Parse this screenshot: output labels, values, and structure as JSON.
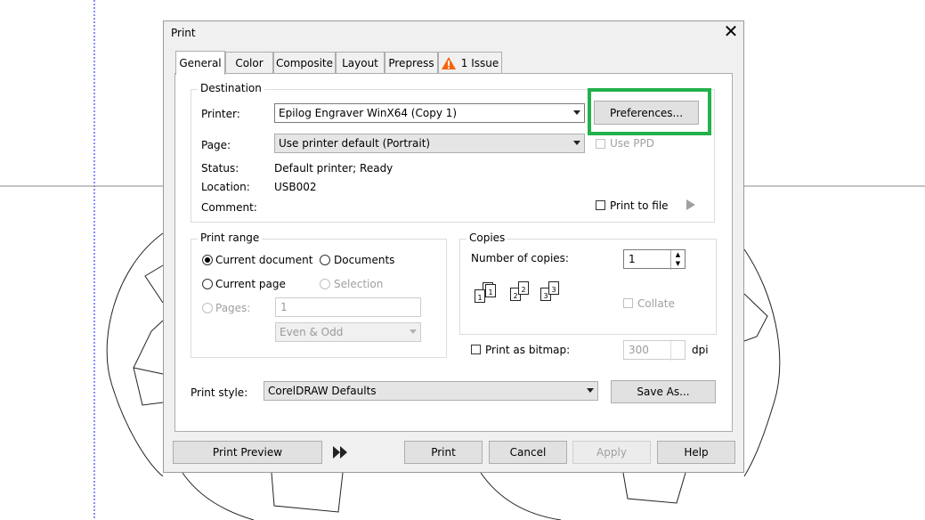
{
  "dialog": {
    "title": "Print",
    "close_icon": "close-icon",
    "tabs": [
      "General",
      "Color",
      "Composite",
      "Layout",
      "Prepress",
      "1 Issue"
    ],
    "issue_icon": "warning-icon",
    "issue_color": "#f7630c"
  },
  "destination": {
    "title": "Destination",
    "printer_label": "Printer:",
    "printer_value": "Epilog Engraver WinX64 (Copy 1)",
    "preferences_button": "Preferences...",
    "page_label": "Page:",
    "page_value": "Use printer default (Portrait)",
    "use_ppd": "Use PPD",
    "status_label": "Status:",
    "status_value": "Default printer; Ready",
    "location_label": "Location:",
    "location_value": "USB002",
    "comment_label": "Comment:",
    "print_to_file": "Print to file"
  },
  "print_range": {
    "title": "Print range",
    "current_document": "Current document",
    "documents": "Documents",
    "current_page": "Current page",
    "selection": "Selection",
    "pages_label": "Pages:",
    "pages_value": "1",
    "even_odd": "Even & Odd"
  },
  "copies": {
    "title": "Copies",
    "number_label": "Number of copies:",
    "number_value": "1",
    "collate": "Collate",
    "uncollated_pages": [
      "1",
      "1"
    ],
    "collated_pages": [
      "2",
      "2",
      "3",
      "3"
    ]
  },
  "bitmap": {
    "label": "Print as bitmap:",
    "dpi_value": "300",
    "dpi_unit": "dpi"
  },
  "style": {
    "label": "Print style:",
    "value": "CorelDRAW Defaults",
    "save_as": "Save As..."
  },
  "footer": {
    "print_preview": "Print Preview",
    "expand_icon": "double-chevron-right-icon",
    "print": "Print",
    "cancel": "Cancel",
    "apply": "Apply",
    "help": "Help"
  },
  "highlight_color": "#22b14c"
}
